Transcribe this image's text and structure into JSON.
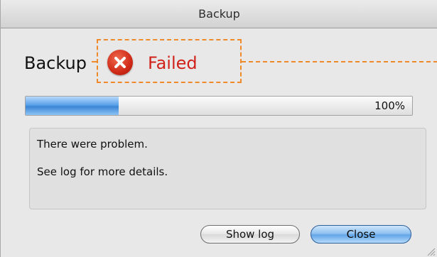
{
  "window": {
    "title": "Backup"
  },
  "header": {
    "heading": "Backup",
    "status_icon": "error-x-icon",
    "status_text": "Failed",
    "status_color": "#d1221a",
    "highlight_color": "#ee8a2a"
  },
  "progress": {
    "value_fraction": 0.24,
    "label": "100%"
  },
  "message": {
    "line1": "There were problem.",
    "line2": "See log for more details."
  },
  "buttons": {
    "show_log": "Show log",
    "close": "Close"
  }
}
